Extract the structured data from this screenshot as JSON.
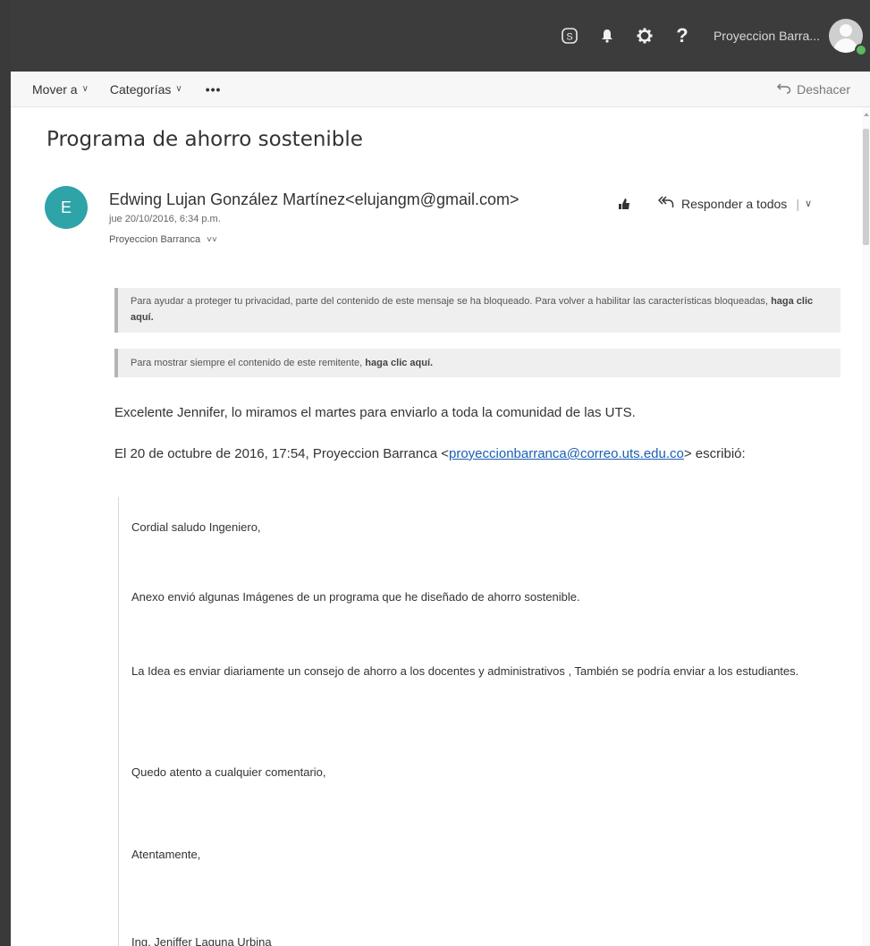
{
  "topbar": {
    "icons": [
      "skype-icon",
      "bell-icon",
      "gear-icon",
      "help-icon"
    ],
    "skype_glyph": "S",
    "help_glyph": "?",
    "user_name": "Proyeccion Barra..."
  },
  "commandbar": {
    "move_label": "Mover a",
    "categories_label": "Categorías",
    "more_label": "•••",
    "undo_label": "Deshacer"
  },
  "message": {
    "subject": "Programa de ahorro sostenible",
    "sender_initial": "E",
    "sender": "Edwing Lujan González Martínez<elujangm@gmail.com>",
    "date": "jue 20/10/2016, 6:34 p.m.",
    "recipient": "Proyeccion Barranca",
    "recipient_expand": "˅˅",
    "reply_all_label": "Responder a todos",
    "notice_1_text": "Para ayudar a proteger tu privacidad, parte del contenido de este mensaje se ha bloqueado. Para volver a habilitar las características bloqueadas, ",
    "notice_1_link": "haga clic aquí.",
    "notice_2_text": "Para mostrar siempre el contenido de este remitente, ",
    "notice_2_link": "haga clic aquí.",
    "body_line_1": "Excelente Jennifer, lo miramos el martes para enviarlo a toda la comunidad de las UTS.",
    "quote_header_pre": "El 20 de octubre de 2016, 17:54, Proyeccion Barranca <",
    "quote_header_email": "proyeccionbarranca@correo.uts.edu.co",
    "quote_header_post": "> escribió:",
    "quote": {
      "greeting": "Cordial saludo Ingeniero,",
      "line_1": "Anexo envió algunas Imágenes de un programa que he diseñado de ahorro sostenible.",
      "line_2": "La Idea es enviar diariamente un consejo de ahorro a los docentes y administrativos , También se podría enviar a los estudiantes.",
      "line_3": "Quedo atento a cualquier comentario,",
      "closing": "Atentamente,",
      "signature": "Ing, Jeniffer Laguna Urbina"
    }
  },
  "colors": {
    "topbar_bg": "#3c3c3c",
    "avatar_bg": "#2ea3a8",
    "link": "#1a5fb4",
    "presence": "#5cb85c"
  }
}
